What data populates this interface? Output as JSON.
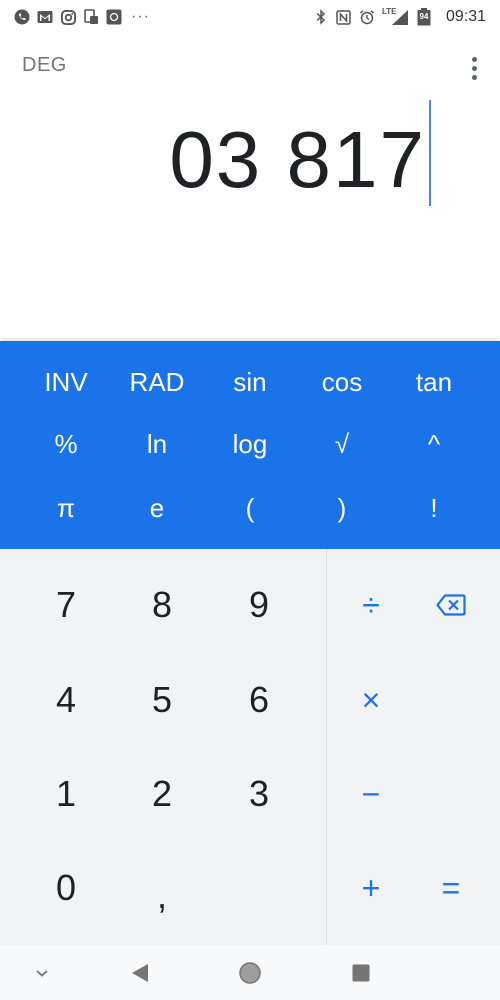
{
  "status_bar": {
    "time": "09:31",
    "battery_level": "94",
    "network_label": "LTE",
    "left_icons": [
      "phone-icon",
      "gmail-icon",
      "instagram-icon",
      "screenshot-icon",
      "photo-icon",
      "more-notifications-icon"
    ],
    "right_icons": [
      "bluetooth-icon",
      "nfc-icon",
      "alarm-icon",
      "signal-icon",
      "battery-icon"
    ]
  },
  "header": {
    "angle_mode": "DEG",
    "menu_icon": "more-vert-icon"
  },
  "display": {
    "formula": "03 817"
  },
  "advanced_keys": [
    [
      "INV",
      "RAD",
      "sin",
      "cos",
      "tan"
    ],
    [
      "%",
      "ln",
      "log",
      "√",
      "^"
    ],
    [
      "π",
      "e",
      "(",
      ")",
      "!"
    ]
  ],
  "number_keys": [
    [
      "7",
      "8",
      "9"
    ],
    [
      "4",
      "5",
      "6"
    ],
    [
      "1",
      "2",
      "3"
    ],
    [
      "0",
      ","
    ]
  ],
  "operator_keys": {
    "divide": "÷",
    "backspace_icon": "backspace-icon",
    "multiply": "×",
    "minus": "−",
    "plus": "+",
    "equals": "="
  },
  "colors": {
    "accent": "#1a73e8",
    "pad_background": "#f1f3f4",
    "digit_text": "#202124"
  },
  "nav_bar": {
    "icons": [
      "chevron-down-icon",
      "back-icon",
      "home-icon",
      "recents-icon"
    ]
  }
}
